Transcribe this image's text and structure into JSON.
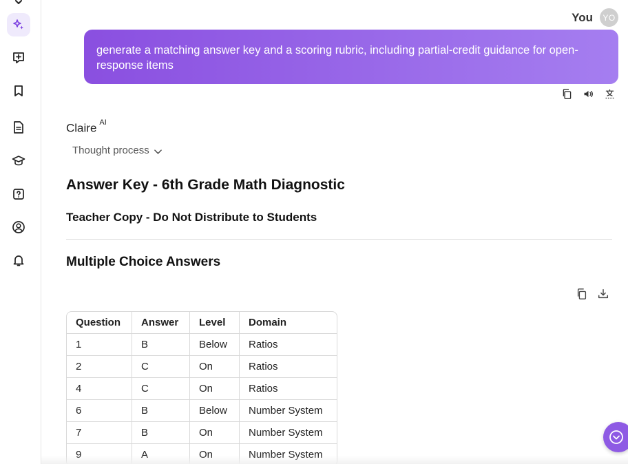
{
  "colors": {
    "accent": "#8a4fe0",
    "accent_light": "#a57ef0",
    "active_bg": "#efeafc"
  },
  "sidebar": {
    "items": [
      {
        "name": "chevron-down-icon"
      },
      {
        "name": "sparkle-icon",
        "active": true
      },
      {
        "name": "add-note-icon"
      },
      {
        "name": "bookmark-icon"
      },
      {
        "name": "document-icon"
      },
      {
        "name": "graduation-cap-icon"
      },
      {
        "name": "help-icon"
      },
      {
        "name": "profile-icon"
      },
      {
        "name": "bell-icon"
      }
    ]
  },
  "user": {
    "name": "You",
    "avatar_initials": "YO",
    "message": "generate a matching answer key and a scoring rubric, including partial-credit guidance for open-response items"
  },
  "message_actions": [
    "copy-icon",
    "speaker-icon",
    "translate-icon"
  ],
  "assistant": {
    "name": "Claire",
    "badge": "AI",
    "thought_process_label": "Thought process"
  },
  "content": {
    "title": "Answer Key - 6th Grade Math Diagnostic",
    "subtitle": "Teacher Copy - Do Not Distribute to Students",
    "section_title": "Multiple Choice Answers"
  },
  "table_actions": [
    "copy-icon",
    "download-icon"
  ],
  "table": {
    "headers": [
      "Question",
      "Answer",
      "Level",
      "Domain"
    ],
    "rows": [
      [
        "1",
        "B",
        "Below",
        "Ratios"
      ],
      [
        "2",
        "C",
        "On",
        "Ratios"
      ],
      [
        "4",
        "C",
        "On",
        "Ratios"
      ],
      [
        "6",
        "B",
        "Below",
        "Number System"
      ],
      [
        "7",
        "B",
        "On",
        "Number System"
      ],
      [
        "9",
        "A",
        "On",
        "Number System"
      ]
    ]
  }
}
